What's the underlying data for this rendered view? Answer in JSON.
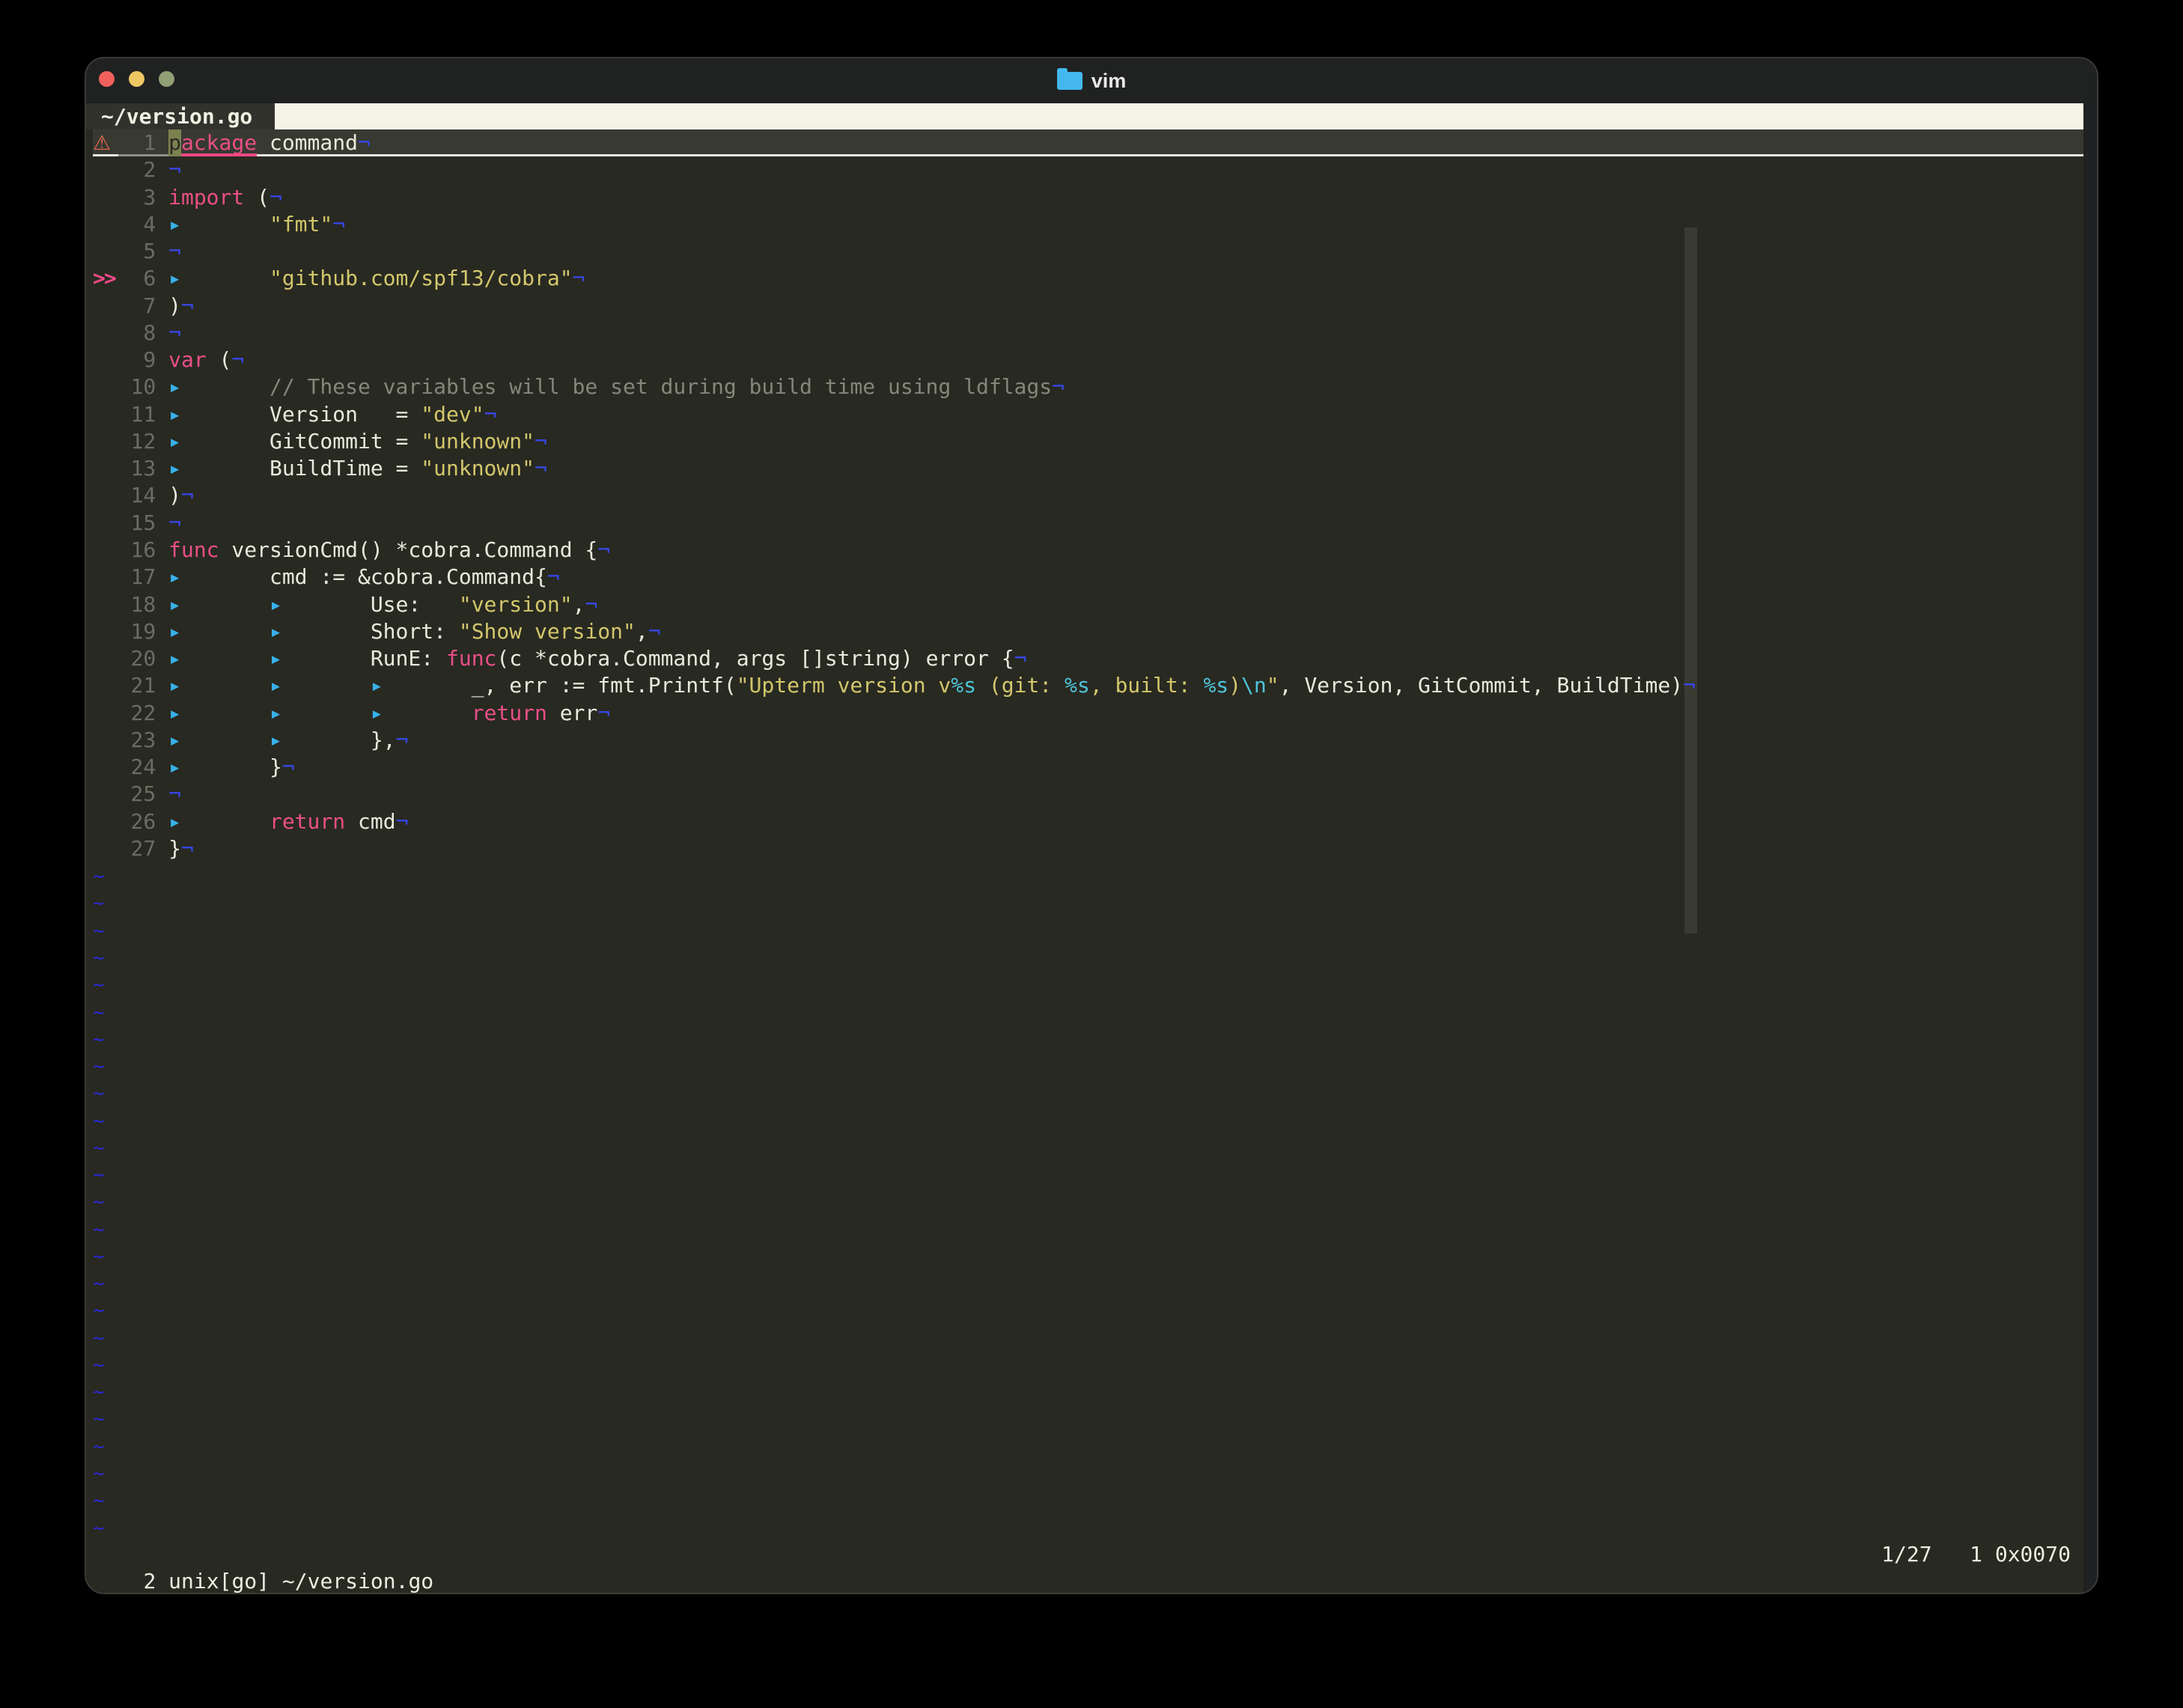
{
  "window": {
    "app_title": "vim",
    "traffic_lights": [
      "close",
      "minimize",
      "zoom"
    ]
  },
  "tabline": {
    "active_tab": "~/version.go"
  },
  "statusline": {
    "left": "2 unix[go] ~/version.go",
    "right": "1/27   1 0x0070",
    "position": "1/27",
    "column": "1",
    "char_value": "0x0070"
  },
  "editor": {
    "filename": "~/version.go",
    "filetype": "go",
    "eol_marker": "¬",
    "tab_marker": "▸",
    "tilde": "~",
    "tilde_count": 25,
    "sign_glyphs": {
      "warning": "⚠",
      "jump": ">>"
    },
    "lines": [
      {
        "n": "1",
        "sign": "warn",
        "cursorline": true,
        "segs": [
          {
            "t": "p",
            "cls": "cursor"
          },
          {
            "t": "ackage",
            "cls": "kw"
          },
          {
            "t": " command",
            "cls": "fg"
          }
        ],
        "eol": true
      },
      {
        "n": "2",
        "segs": [],
        "eol": true
      },
      {
        "n": "3",
        "segs": [
          {
            "t": "import",
            "cls": "kw"
          },
          {
            "t": " (",
            "cls": "fg"
          }
        ],
        "eol": true
      },
      {
        "n": "4",
        "tabs": 1,
        "segs": [
          {
            "t": "\"fmt\"",
            "cls": "str"
          }
        ],
        "eol": true
      },
      {
        "n": "5",
        "segs": [],
        "eol": true
      },
      {
        "n": "6",
        "sign": "jump",
        "tabs": 1,
        "segs": [
          {
            "t": "\"github.com/spf13/cobra\"",
            "cls": "str"
          }
        ],
        "eol": true
      },
      {
        "n": "7",
        "segs": [
          {
            "t": ")",
            "cls": "fg"
          }
        ],
        "eol": true
      },
      {
        "n": "8",
        "segs": [],
        "eol": true
      },
      {
        "n": "9",
        "segs": [
          {
            "t": "var",
            "cls": "kw"
          },
          {
            "t": " (",
            "cls": "fg"
          }
        ],
        "eol": true
      },
      {
        "n": "10",
        "tabs": 1,
        "segs": [
          {
            "t": "// These variables will be set during build time using ldflags",
            "cls": "com"
          }
        ],
        "eol": true
      },
      {
        "n": "11",
        "tabs": 1,
        "segs": [
          {
            "t": "Version   = ",
            "cls": "fg"
          },
          {
            "t": "\"dev\"",
            "cls": "str"
          }
        ],
        "eol": true
      },
      {
        "n": "12",
        "tabs": 1,
        "segs": [
          {
            "t": "GitCommit = ",
            "cls": "fg"
          },
          {
            "t": "\"unknown\"",
            "cls": "str"
          }
        ],
        "eol": true
      },
      {
        "n": "13",
        "tabs": 1,
        "segs": [
          {
            "t": "BuildTime = ",
            "cls": "fg"
          },
          {
            "t": "\"unknown\"",
            "cls": "str"
          }
        ],
        "eol": true
      },
      {
        "n": "14",
        "segs": [
          {
            "t": ")",
            "cls": "fg"
          }
        ],
        "eol": true
      },
      {
        "n": "15",
        "segs": [],
        "eol": true
      },
      {
        "n": "16",
        "segs": [
          {
            "t": "func",
            "cls": "kw"
          },
          {
            "t": " versionCmd() *cobra.Command {",
            "cls": "fg"
          }
        ],
        "eol": true
      },
      {
        "n": "17",
        "tabs": 1,
        "segs": [
          {
            "t": "cmd := &cobra.Command{",
            "cls": "fg"
          }
        ],
        "eol": true
      },
      {
        "n": "18",
        "tabs": 2,
        "segs": [
          {
            "t": "Use:   ",
            "cls": "fg"
          },
          {
            "t": "\"version\"",
            "cls": "str"
          },
          {
            "t": ",",
            "cls": "fg"
          }
        ],
        "eol": true
      },
      {
        "n": "19",
        "tabs": 2,
        "segs": [
          {
            "t": "Short: ",
            "cls": "fg"
          },
          {
            "t": "\"Show version\"",
            "cls": "str"
          },
          {
            "t": ",",
            "cls": "fg"
          }
        ],
        "eol": true
      },
      {
        "n": "20",
        "tabs": 2,
        "segs": [
          {
            "t": "RunE: ",
            "cls": "fg"
          },
          {
            "t": "func",
            "cls": "kw"
          },
          {
            "t": "(c *cobra.Command, args []string) error {",
            "cls": "fg"
          }
        ],
        "eol": true
      },
      {
        "n": "21",
        "tabs": 3,
        "segs": [
          {
            "t": "_, err := fmt.Printf(",
            "cls": "fg"
          },
          {
            "t": "\"Upterm version v",
            "cls": "str"
          },
          {
            "t": "%s",
            "cls": "spec"
          },
          {
            "t": " (git: ",
            "cls": "str"
          },
          {
            "t": "%s",
            "cls": "spec"
          },
          {
            "t": ", built: ",
            "cls": "str"
          },
          {
            "t": "%s",
            "cls": "spec"
          },
          {
            "t": ")",
            "cls": "str"
          },
          {
            "t": "\\n",
            "cls": "spec"
          },
          {
            "t": "\"",
            "cls": "str"
          },
          {
            "t": ", Version, GitCommit, BuildTime)",
            "cls": "fg"
          }
        ],
        "eol": true
      },
      {
        "n": "22",
        "tabs": 3,
        "segs": [
          {
            "t": "return",
            "cls": "kw"
          },
          {
            "t": " err",
            "cls": "fg"
          }
        ],
        "eol": true
      },
      {
        "n": "23",
        "tabs": 2,
        "segs": [
          {
            "t": "},",
            "cls": "fg"
          }
        ],
        "eol": true
      },
      {
        "n": "24",
        "tabs": 1,
        "segs": [
          {
            "t": "}",
            "cls": "fg"
          }
        ],
        "eol": true
      },
      {
        "n": "25",
        "segs": [],
        "eol": true
      },
      {
        "n": "26",
        "tabs": 1,
        "segs": [
          {
            "t": "return",
            "cls": "kw"
          },
          {
            "t": " cmd",
            "cls": "fg"
          }
        ],
        "eol": true
      },
      {
        "n": "27",
        "segs": [
          {
            "t": "}",
            "cls": "fg"
          }
        ],
        "eol": true
      }
    ]
  },
  "colors": {
    "window_bg": "#282921",
    "titlebar_bg": "#202121",
    "window_border": "#3a3b35",
    "traffic_red": "#f2605c",
    "traffic_yellow": "#eec763",
    "traffic_green": "#90a074",
    "title_fg": "#e8e9e8",
    "folder_blue": "#43b7ee",
    "tab_active_bg": "#31322b",
    "tab_active_fg": "#eef0e2",
    "tabline_fill": "#f5f4e6",
    "text": "#e9e9dc",
    "keyword": "#e94f87",
    "string": "#d3c76c",
    "special": "#4fc4d9",
    "comment": "#85867a",
    "line_number": "#6b6c62",
    "cursor_bg": "#7c8150",
    "cursorline_bg": "#383931",
    "cursorline_underline": "#eff0e3",
    "number_underline": "#8e8f85",
    "spell_underline": "#ec4882",
    "eol_marker": "#3647e6",
    "tilde": "#2929d3",
    "tab_marker": "#38b1e8",
    "colorcolumn": "#393a32",
    "sign_warning": "#e5694f",
    "sign_jump": "#ee4b86",
    "status_fg": "#edecdf",
    "right_margin": "#202123"
  }
}
